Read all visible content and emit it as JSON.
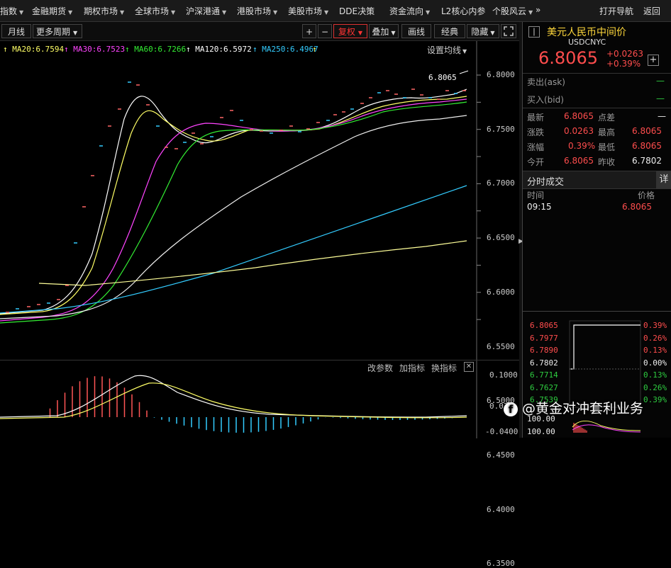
{
  "menu": {
    "items": [
      {
        "label": "指数",
        "caret": true
      },
      {
        "label": "金融期货",
        "caret": true
      },
      {
        "label": "期权市场",
        "caret": true
      },
      {
        "label": "全球市场",
        "caret": true
      },
      {
        "label": "沪深港通",
        "caret": true
      },
      {
        "label": "港股市场",
        "caret": true
      },
      {
        "label": "美股市场",
        "caret": true
      },
      {
        "label": "DDE决策",
        "caret": false
      },
      {
        "label": "资金流向",
        "caret": true
      },
      {
        "label": "L2核心内参",
        "caret": false
      },
      {
        "label": "个股风云",
        "caret": true
      }
    ],
    "more": "»",
    "open_nav": "打开导航",
    "back": "返回"
  },
  "toolbar": {
    "period": "月线",
    "more_period": "更多周期",
    "plus": "+",
    "minus": "−",
    "fuquan": "复权",
    "overlay": "叠加",
    "draw": "画线",
    "classic": "经典",
    "hide": "隐藏",
    "fullscreen_icon": "fullscreen-icon"
  },
  "ma_legend": [
    {
      "label": "MA20:6.7594",
      "color": "#ffff66"
    },
    {
      "label": "MA30:6.7523",
      "color": "#ff44ff"
    },
    {
      "label": "MA60:6.7266",
      "color": "#33ee33"
    },
    {
      "label": "MA120:6.5972",
      "color": "#ffffff"
    },
    {
      "label": "MA250:6.4967",
      "color": "#33ccff"
    }
  ],
  "ma_settings": "设置均线",
  "last_price_tag": "6.8065",
  "main_axis": [
    "6.8000",
    "6.7500",
    "6.7000",
    "6.6500",
    "6.6000",
    "6.5500",
    "6.5000",
    "6.4500",
    "6.4000",
    "6.3500"
  ],
  "sub_chart": {
    "edit_params": "改参数",
    "add_indicator": "加指标",
    "switch_indicator": "换指标",
    "axis": [
      "0.1000",
      "0.030",
      "-0.0400"
    ]
  },
  "quote": {
    "name": "美元人民币中间价",
    "code": "USDCNYC",
    "price": "6.8065",
    "change": "+0.0263",
    "change_pct": "+0.39%",
    "ask_label": "卖出(ask)",
    "ask_value": "—",
    "bid_label": "买入(bid)",
    "bid_value": "—",
    "stats": {
      "latest_label": "最新",
      "latest": "6.8065",
      "point_diff_label": "点差",
      "point_diff": "—",
      "change_label": "涨跌",
      "change": "0.0263",
      "high_label": "最高",
      "high": "6.8065",
      "range_label": "涨幅",
      "range": "0.39%",
      "low_label": "最低",
      "low": "6.8065",
      "open_label": "今开",
      "open": "6.8065",
      "prev_close_label": "昨收",
      "prev_close": "6.7802"
    },
    "trades_title": "分时成交",
    "trades_detail": "详",
    "trades_col_time": "时间",
    "trades_col_price": "价格",
    "trades": [
      {
        "time": "09:15",
        "price": "6.8065"
      }
    ]
  },
  "mini_chart": {
    "left_axis": [
      "6.8065",
      "6.7977",
      "6.7890",
      "6.7802",
      "6.7714",
      "6.7627",
      "6.7539"
    ],
    "right_axis": [
      "0.39%",
      "0.26%",
      "0.13%",
      "0.00%",
      "0.13%",
      "0.26%",
      "0.39%"
    ],
    "vol_axis": [
      "100.00",
      "100.00"
    ]
  },
  "watermark": "@黄金对冲套利业务",
  "colors": {
    "up": "#ff4d4d",
    "down": "#2ecc40",
    "accent": "#d33"
  }
}
